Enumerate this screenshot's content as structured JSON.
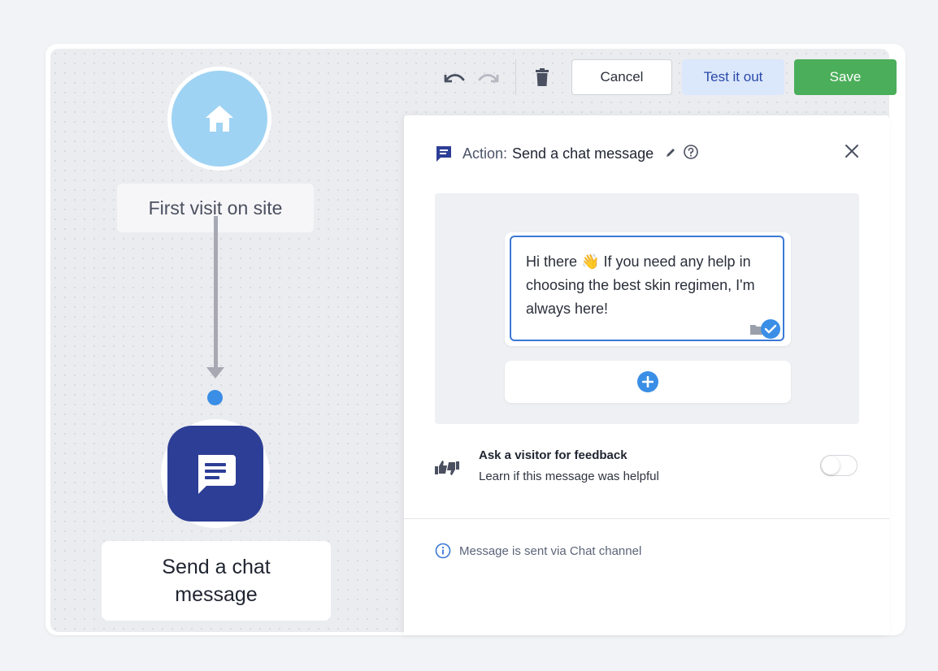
{
  "flow": {
    "trigger_label": "First visit on site",
    "action_label": "Send a chat message"
  },
  "toolbar": {
    "undo_icon": "undo-icon",
    "redo_icon": "redo-icon",
    "delete_icon": "trash-icon",
    "cancel_label": "Cancel",
    "test_label": "Test it out",
    "save_label": "Save"
  },
  "panel": {
    "header_prefix": "Action:",
    "header_title": "Send a chat message",
    "message_text": "Hi there 👋 If you need any help in choosing the best skin regimen, I'm always here!",
    "feedback": {
      "title": "Ask a visitor for feedback",
      "subtitle": "Learn if this message was helpful",
      "enabled": false
    },
    "info_text": "Message is sent via Chat channel"
  },
  "colors": {
    "accent_blue": "#3a8ee6",
    "save_green": "#4bae5a",
    "node_navy": "#2d3e96",
    "home_light_blue": "#9fd3f3"
  }
}
